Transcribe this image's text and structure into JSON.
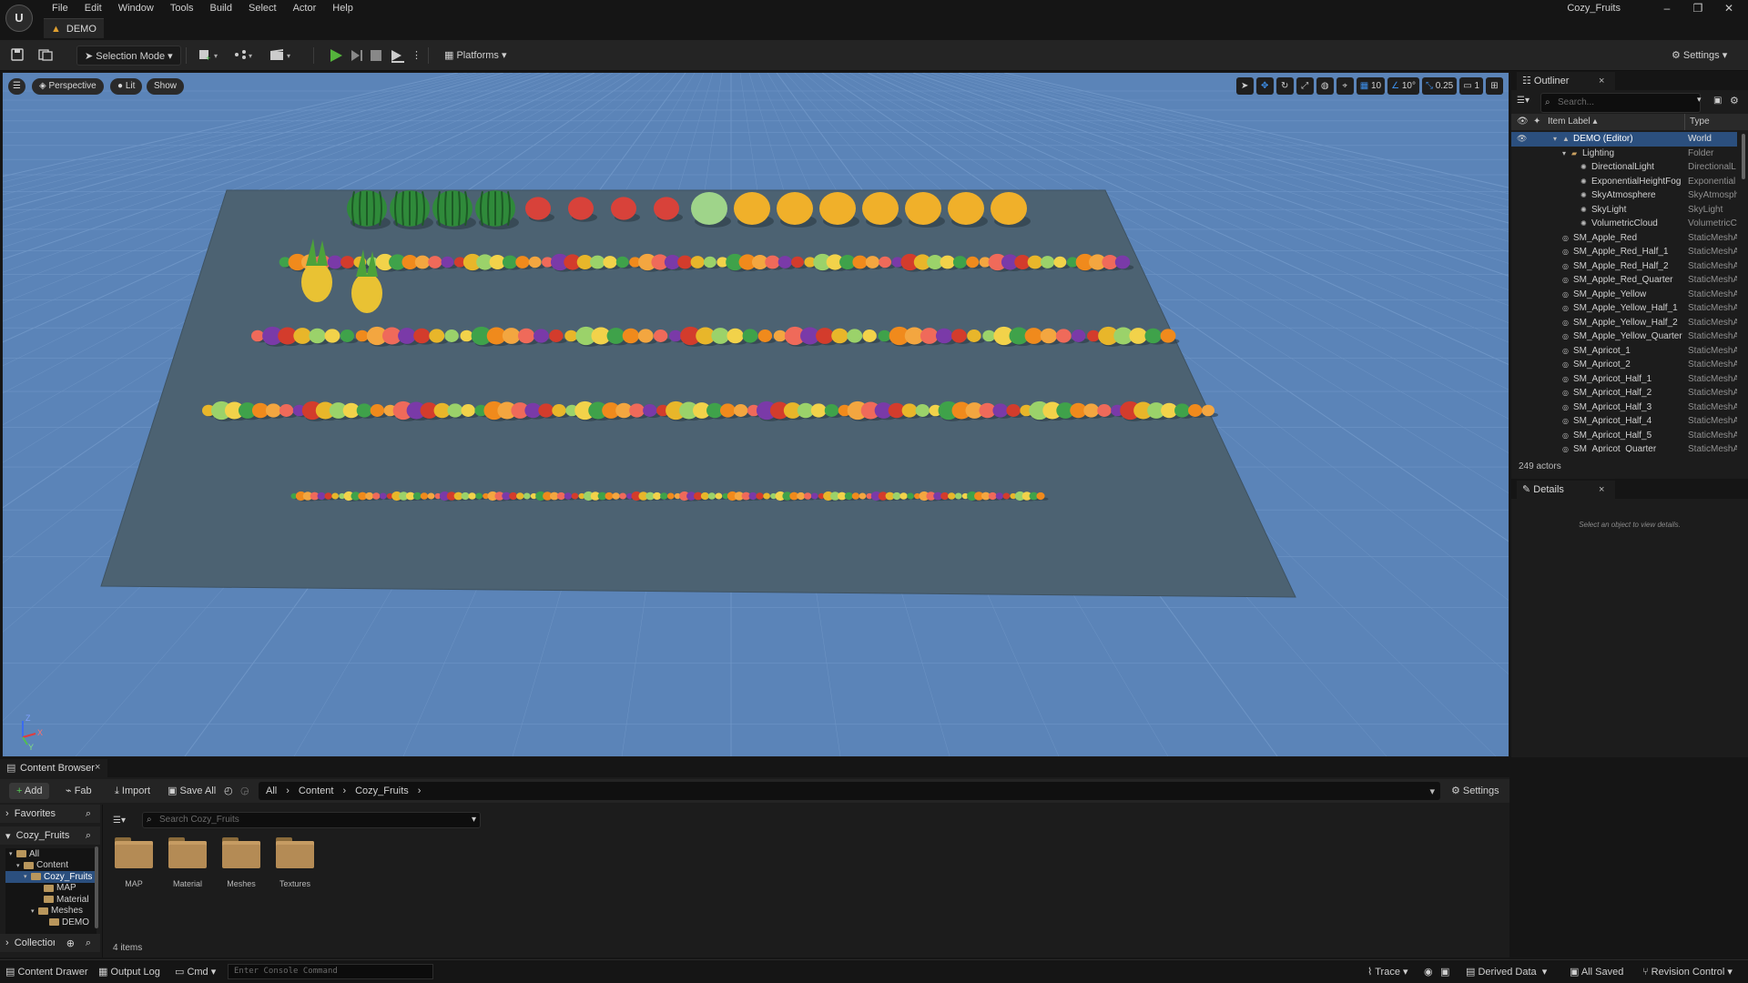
{
  "window": {
    "title": "Cozy_Fruits",
    "level_tab": "DEMO",
    "controls": [
      "–",
      "❐",
      "✕"
    ]
  },
  "menu": [
    "File",
    "Edit",
    "Window",
    "Tools",
    "Build",
    "Select",
    "Actor",
    "Help"
  ],
  "toolbar": {
    "selection_mode": "Selection Mode",
    "platforms": "Platforms",
    "settings": "Settings"
  },
  "viewport": {
    "perspective": "Perspective",
    "lit": "Lit",
    "show": "Show",
    "grid_snap": "10",
    "rotation_snap": "10°",
    "scale_snap": "0.25",
    "camera_speed": "1"
  },
  "outliner": {
    "tab": "Outliner",
    "search_placeholder": "Search...",
    "col_label": "Item Label ▴",
    "col_type": "Type",
    "rows": [
      {
        "label": "DEMO (Editor)",
        "type": "World"
      },
      {
        "label": "Lighting",
        "type": "Folder"
      },
      {
        "label": "DirectionalLight",
        "type": "DirectionalL"
      },
      {
        "label": "ExponentialHeightFog",
        "type": "Exponential"
      },
      {
        "label": "SkyAtmosphere",
        "type": "SkyAtmosph"
      },
      {
        "label": "SkyLight",
        "type": "SkyLight"
      },
      {
        "label": "VolumetricCloud",
        "type": "VolumetricC"
      },
      {
        "label": "SM_Apple_Red",
        "type": "StaticMeshA"
      },
      {
        "label": "SM_Apple_Red_Half_1",
        "type": "StaticMeshA"
      },
      {
        "label": "SM_Apple_Red_Half_2",
        "type": "StaticMeshA"
      },
      {
        "label": "SM_Apple_Red_Quarter",
        "type": "StaticMeshA"
      },
      {
        "label": "SM_Apple_Yellow",
        "type": "StaticMeshA"
      },
      {
        "label": "SM_Apple_Yellow_Half_1",
        "type": "StaticMeshA"
      },
      {
        "label": "SM_Apple_Yellow_Half_2",
        "type": "StaticMeshA"
      },
      {
        "label": "SM_Apple_Yellow_Quarter",
        "type": "StaticMeshA"
      },
      {
        "label": "SM_Apricot_1",
        "type": "StaticMeshA"
      },
      {
        "label": "SM_Apricot_2",
        "type": "StaticMeshA"
      },
      {
        "label": "SM_Apricot_Half_1",
        "type": "StaticMeshA"
      },
      {
        "label": "SM_Apricot_Half_2",
        "type": "StaticMeshA"
      },
      {
        "label": "SM_Apricot_Half_3",
        "type": "StaticMeshA"
      },
      {
        "label": "SM_Apricot_Half_4",
        "type": "StaticMeshA"
      },
      {
        "label": "SM_Apricot_Half_5",
        "type": "StaticMeshA"
      },
      {
        "label": "SM_Apricot_Quarter",
        "type": "StaticMeshA"
      }
    ],
    "actor_count": "249 actors"
  },
  "details": {
    "tab": "Details",
    "empty_message": "Select an object to view details."
  },
  "content_browser": {
    "tab": "Content Browser",
    "add": "Add",
    "fab": "Fab",
    "import": "Import",
    "save_all": "Save All",
    "breadcrumb": [
      "All",
      "Content",
      "Cozy_Fruits"
    ],
    "settings": "Settings",
    "favorites": "Favorites",
    "cozy_header": "Cozy_Fruits",
    "search_placeholder": "Search Cozy_Fruits",
    "tree": [
      "All",
      "Content",
      "Cozy_Fruits",
      "MAP",
      "Material",
      "Meshes",
      "DEMO"
    ],
    "folders": [
      "MAP",
      "Material",
      "Meshes",
      "Textures"
    ],
    "collections": "Collections",
    "item_count": "4 items"
  },
  "statusbar": {
    "content_drawer": "Content Drawer",
    "output_log": "Output Log",
    "cmd": "Cmd",
    "console_placeholder": "Enter Console Command",
    "trace": "Trace",
    "derived_data": "Derived Data",
    "all_saved": "All Saved",
    "revision_control": "Revision Control"
  },
  "colors": {
    "viewport_bg": "#5b84b8",
    "plane": "#4e6373",
    "selection": "#2b4f7e",
    "play": "#55b43c"
  }
}
